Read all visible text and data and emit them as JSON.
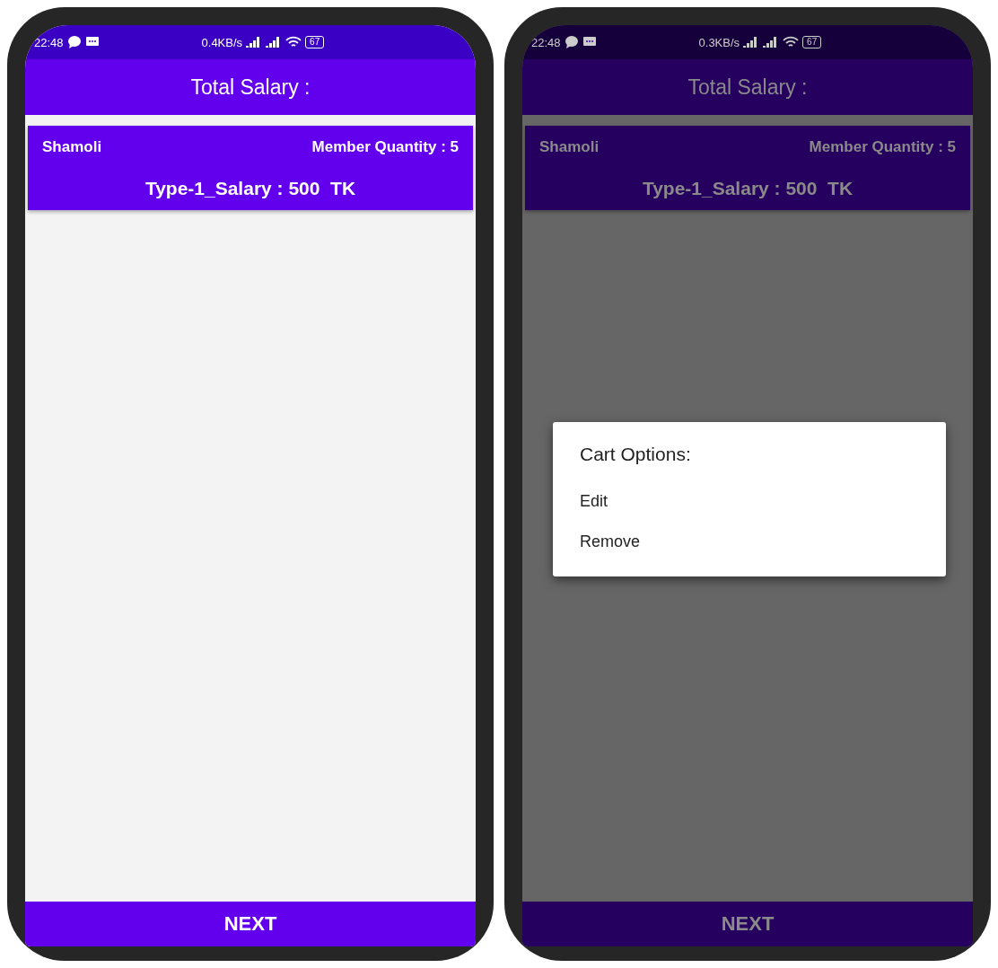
{
  "phones": [
    {
      "dimmed": false,
      "status_bar": {
        "time": "22:48",
        "speed": "0.4KB/s",
        "battery": "67"
      },
      "title": "Total Salary :",
      "cards": [
        {
          "name": "Shamoli",
          "members": "Member Quantity : 5",
          "salary": "Type-1_Salary : 500  TK"
        }
      ],
      "next_button": "NEXT"
    },
    {
      "dimmed": true,
      "status_bar": {
        "time": "22:48",
        "speed": "0.3KB/s",
        "battery": "67"
      },
      "title": "Total Salary :",
      "cards": [
        {
          "name": "Shamoli",
          "members": "Member Quantity : 5",
          "salary": "Type-1_Salary : 500  TK"
        }
      ],
      "next_button": "NEXT",
      "dialog": {
        "title": "Cart Options:",
        "options": [
          "Edit",
          "Remove"
        ]
      }
    }
  ]
}
